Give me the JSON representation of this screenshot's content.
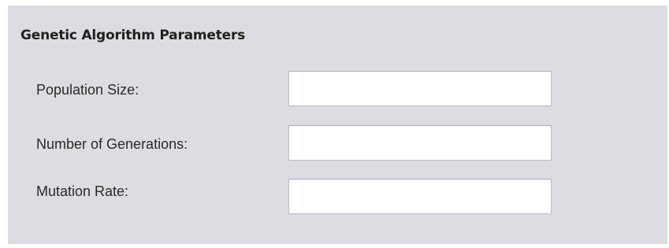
{
  "panel": {
    "title": "Genetic Algorithm Parameters"
  },
  "fields": [
    {
      "label": "Population Size:",
      "value": "",
      "placeholder": ""
    },
    {
      "label": "Number of Generations:",
      "value": "",
      "placeholder": ""
    },
    {
      "label": "Mutation Rate:",
      "value": "",
      "placeholder": ""
    }
  ],
  "colors": {
    "panel_background": "#dcdde3",
    "field_background": "#ffffff",
    "field_border": "#b9bcc4",
    "text": "#2a2a2a"
  }
}
